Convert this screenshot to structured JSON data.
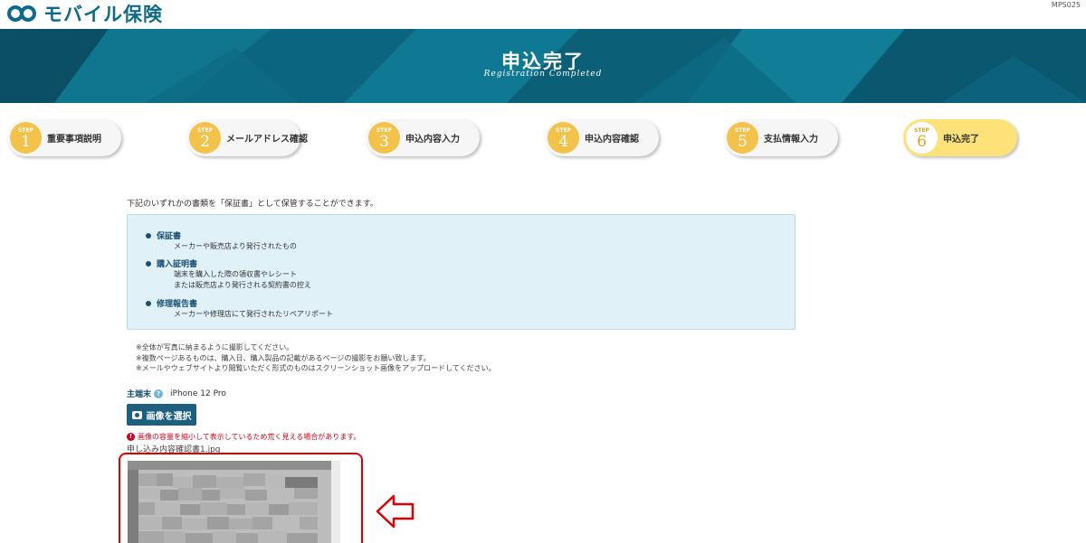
{
  "header": {
    "logo_text": "モバイル保険",
    "page_code": "MPS025"
  },
  "hero": {
    "title": "申込完了",
    "subtitle": "Registration Completed"
  },
  "steps": [
    {
      "word": "STEP",
      "num": "1",
      "label": "重要事項説明"
    },
    {
      "word": "STEP",
      "num": "2",
      "label": "メールアドレス確認"
    },
    {
      "word": "STEP",
      "num": "3",
      "label": "申込内容入力"
    },
    {
      "word": "STEP",
      "num": "4",
      "label": "申込内容確認"
    },
    {
      "word": "STEP",
      "num": "5",
      "label": "支払情報入力"
    },
    {
      "word": "STEP",
      "num": "6",
      "label": "申込完了"
    }
  ],
  "intro": "下記のいずれかの書類を「保証書」として保管することができます。",
  "documents": [
    {
      "title": "保証書",
      "lines": [
        "メーカーや販売店より発行されたもの"
      ]
    },
    {
      "title": "購入証明書",
      "lines": [
        "端末を購入した際の領収書やレシート",
        "または販売店より発行される契約書の控え"
      ]
    },
    {
      "title": "修理報告書",
      "lines": [
        "メーカーや修理店にて発行されたリペアリポート"
      ]
    }
  ],
  "notes": [
    "※全体が写真に納まるように撮影してください。",
    "※複数ページあるものは、購入日、購入製品の記載があるページの撮影をお願い致します。",
    "※メールやウェブサイトより閲覧いただく形式のものはスクリーンショット画像をアップロードしてください。"
  ],
  "device": {
    "label": "主端末",
    "value": "iPhone 12 Pro"
  },
  "select_button": "画像を選択",
  "warning": "画像の容量を縮小して表示しているため荒く見える場合があります。",
  "filename": "申し込み内容確認書1.jpg",
  "colors": {
    "brand": "#0e6a8a",
    "button": "#1c5f7e",
    "active_step": "#fde27a",
    "step_badge": "#f2c24a",
    "warning": "#d0021b",
    "highlight": "#e00000"
  }
}
